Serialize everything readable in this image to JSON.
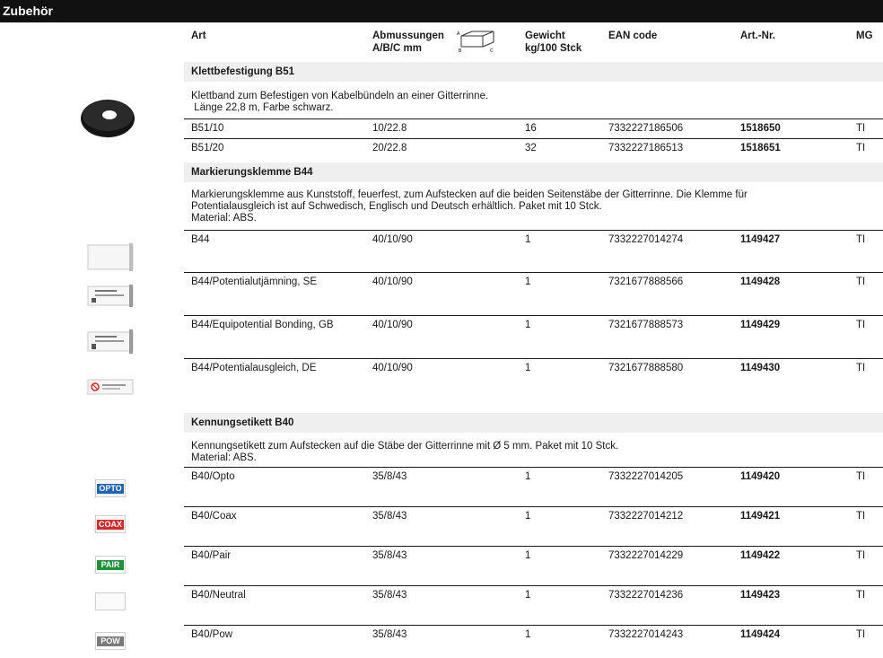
{
  "page_title": "Zubehör",
  "headers": {
    "art": "Art",
    "dims_line1": "Abmussungen",
    "dims_line2": "A/B/C mm",
    "weight_line1": "Gewicht",
    "weight_line2": "kg/100 Stck",
    "ean": "EAN code",
    "artnr": "Art.-Nr.",
    "mg": "MG"
  },
  "sections": [
    {
      "title": "Klettbefestigung B51",
      "desc1": "Klettband zum Befestigen von Kabelbündeln an einer Gitterrinne.",
      "desc2": " Länge 22,8 m, Farbe schwarz.",
      "rows": [
        {
          "art": "B51/10",
          "dims": "10/22.8",
          "weight": "16",
          "ean": "7332227186506",
          "artnr": "1518650",
          "mg": "TI"
        },
        {
          "art": "B51/20",
          "dims": "20/22.8",
          "weight": "32",
          "ean": "7332227186513",
          "artnr": "1518651",
          "mg": "TI"
        }
      ]
    },
    {
      "title": "Markierungsklemme B44",
      "desc1": "Markierungsklemme aus Kunststoff, feuerfest, zum Aufstecken auf die beiden Seitenstäbe der Gitterrinne. Die Klemme für",
      "desc2": "Potentialausgleich ist auf Schwedisch, Englisch und Deutsch erhältlich. Paket mit 10 Stck.",
      "desc3": "Material: ABS.",
      "rows": [
        {
          "art": "B44",
          "dims": "40/10/90",
          "weight": "1",
          "ean": "7332227014274",
          "artnr": "1149427",
          "mg": "TI"
        },
        {
          "art": "B44/Potentialutjämning, SE",
          "dims": "40/10/90",
          "weight": "1",
          "ean": "7321677888566",
          "artnr": "1149428",
          "mg": "TI"
        },
        {
          "art": "B44/Equipotential Bonding, GB",
          "dims": "40/10/90",
          "weight": "1",
          "ean": "7321677888573",
          "artnr": "1149429",
          "mg": "TI"
        },
        {
          "art": "B44/Potentialausgleich, DE",
          "dims": "40/10/90",
          "weight": "1",
          "ean": "7321677888580",
          "artnr": "1149430",
          "mg": "TI"
        }
      ]
    },
    {
      "title": "Kennungsetikett B40",
      "desc1": "Kennungsetikett zum Aufstecken auf die Stäbe der Gitterrinne mit Ø 5 mm. Paket mit 10 Stck.",
      "desc2": "Material: ABS.",
      "rows": [
        {
          "art": "B40/Opto",
          "dims": "35/8/43",
          "weight": "1",
          "ean": "7332227014205",
          "artnr": "1149420",
          "mg": "TI"
        },
        {
          "art": "B40/Coax",
          "dims": "35/8/43",
          "weight": "1",
          "ean": "7332227014212",
          "artnr": "1149421",
          "mg": "TI"
        },
        {
          "art": "B40/Pair",
          "dims": "35/8/43",
          "weight": "1",
          "ean": "7332227014229",
          "artnr": "1149422",
          "mg": "TI"
        },
        {
          "art": "B40/Neutral",
          "dims": "35/8/43",
          "weight": "1",
          "ean": "7332227014236",
          "artnr": "1149423",
          "mg": "TI"
        },
        {
          "art": "B40/Pow",
          "dims": "35/8/43",
          "weight": "1",
          "ean": "7332227014243",
          "artnr": "1149424",
          "mg": "TI"
        }
      ]
    }
  ],
  "dims_icon_letters": {
    "a": "A",
    "b": "B",
    "c": "C"
  },
  "label_texts": {
    "opto": "OPTO",
    "coax": "COAX",
    "pair": "PAIR",
    "pow": "POW"
  },
  "colors": {
    "header_bar": "#111111",
    "section_bg": "#efefef",
    "opto": "#1f63b5",
    "coax": "#d42a2a",
    "pair": "#1f8f3a",
    "pow": "#7a7a7a"
  }
}
